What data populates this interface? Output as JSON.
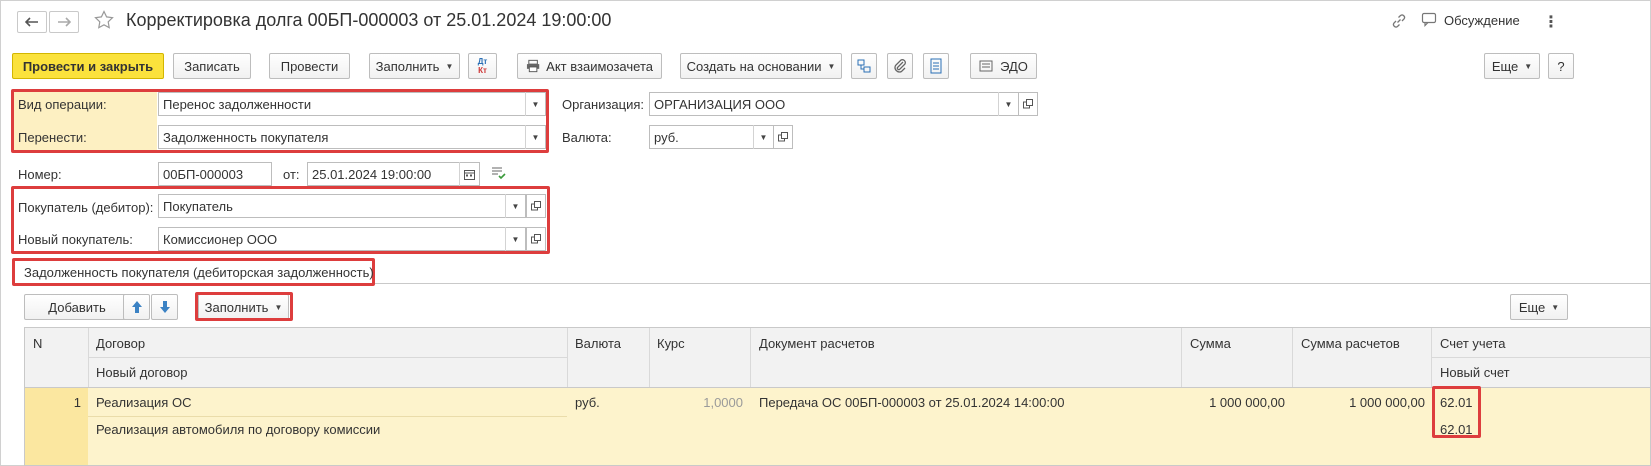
{
  "window": {
    "title": "Корректировка долга 00БП-000003 от 25.01.2024 19:00:00",
    "discussion_label": "Обсуждение"
  },
  "toolbar": {
    "post_and_close": "Провести и закрыть",
    "save": "Записать",
    "post": "Провести",
    "fill": "Заполнить",
    "dt_kt_top": "Дт",
    "dt_kt_bottom": "Кт",
    "offset_act": "Акт взаимозачета",
    "create_based_on": "Создать на основании",
    "edo": "ЭДО",
    "more": "Еще",
    "help": "?"
  },
  "form": {
    "operation_type_label": "Вид операции:",
    "operation_type_value": "Перенос задолженности",
    "transfer_label": "Перенести:",
    "transfer_value": "Задолженность покупателя",
    "organization_label": "Организация:",
    "organization_value": "ОРГАНИЗАЦИЯ ООО",
    "currency_label": "Валюта:",
    "currency_value": "руб.",
    "number_label": "Номер:",
    "number_value": "00БП-000003",
    "date_label": "от:",
    "date_value": "25.01.2024 19:00:00",
    "buyer_label": "Покупатель (дебитор):",
    "buyer_value": "Покупатель",
    "new_buyer_label": "Новый покупатель:",
    "new_buyer_value": "Комиссионер ООО"
  },
  "tab": {
    "label": "Задолженность покупателя (дебиторская задолженность)"
  },
  "table_toolbar": {
    "add": "Добавить",
    "fill": "Заполнить",
    "more": "Еще"
  },
  "table": {
    "headers": {
      "n": "N",
      "contract": "Договор",
      "new_contract": "Новый договор",
      "currency": "Валюта",
      "rate": "Курс",
      "document": "Документ расчетов",
      "amount": "Сумма",
      "settlement_amount": "Сумма расчетов",
      "account": "Счет учета",
      "new_account": "Новый счет"
    },
    "rows": [
      {
        "n": "1",
        "contract": "Реализация ОС",
        "new_contract": "Реализация автомобиля по договору комиссии",
        "currency": "руб.",
        "rate": "1,0000",
        "document": "Передача ОС 00БП-000003 от 25.01.2024 14:00:00",
        "amount": "1 000 000,00",
        "settlement_amount": "1 000 000,00",
        "account": "62.01",
        "new_account": "62.01"
      }
    ]
  },
  "colors": {
    "accent_yellow": "#fbe23c",
    "highlight_red": "#dd3d3d",
    "row_selected": "#fdf0c2"
  }
}
